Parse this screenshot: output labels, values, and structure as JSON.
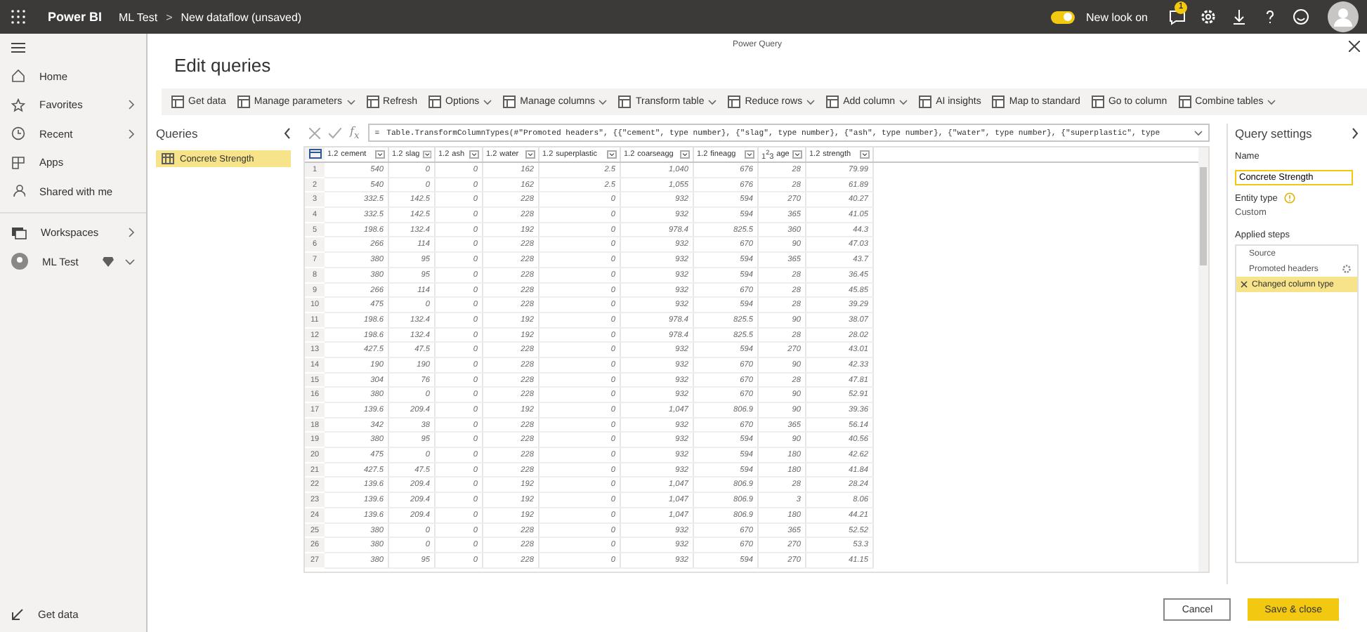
{
  "topbar": {
    "app": "Power BI",
    "breadcrumb": [
      "ML Test",
      "New dataflow (unsaved)"
    ],
    "separator": ">",
    "new_look": {
      "label": "New look on",
      "on": true
    },
    "notifications": "1"
  },
  "nav": {
    "items": [
      {
        "label": "Home",
        "chevron": false
      },
      {
        "label": "Favorites",
        "chevron": true
      },
      {
        "label": "Recent",
        "chevron": true
      },
      {
        "label": "Apps",
        "chevron": false
      },
      {
        "label": "Shared with me",
        "chevron": false
      }
    ],
    "workspaces": [
      {
        "label": "Workspaces",
        "kind": "link"
      },
      {
        "label": "ML Test",
        "kind": "workspace"
      }
    ],
    "footer": "Get data"
  },
  "dialog": {
    "caption": "Power Query",
    "title": "Edit queries",
    "toolbar": [
      {
        "label": "Get data",
        "dropdown": false
      },
      {
        "label": "Manage parameters",
        "dropdown": true
      },
      {
        "label": "Refresh",
        "dropdown": false
      },
      {
        "label": "Options",
        "dropdown": true
      },
      {
        "label": "Manage columns",
        "dropdown": true
      },
      {
        "label": "Transform table",
        "dropdown": true
      },
      {
        "label": "Reduce rows",
        "dropdown": true
      },
      {
        "label": "Add column",
        "dropdown": true
      },
      {
        "label": "AI insights",
        "dropdown": false
      },
      {
        "label": "Map to standard",
        "dropdown": false
      },
      {
        "label": "Go to column",
        "dropdown": false
      },
      {
        "label": "Combine tables",
        "dropdown": true
      }
    ],
    "queries": {
      "title": "Queries",
      "items": [
        {
          "label": "Concrete Strength",
          "selected": true
        }
      ]
    },
    "formula": {
      "fx": "f$_{x}$",
      "prefix": "=",
      "text": "Table.TransformColumnTypes(#\"Promoted headers\", {{\"cement\", type number}, {\"slag\", type number}, {\"ash\", type number}, {\"water\", type number}, {\"superplastic\", type"
    },
    "table": {
      "columns": [
        {
          "type": "1.2",
          "name": "cement"
        },
        {
          "type": "1.2",
          "name": "slag"
        },
        {
          "type": "1.2",
          "name": "ash"
        },
        {
          "type": "1.2",
          "name": "water"
        },
        {
          "type": "1.2",
          "name": "superplastic"
        },
        {
          "type": "1.2",
          "name": "coarseagg"
        },
        {
          "type": "1.2",
          "name": "fineagg"
        },
        {
          "type": "1$^{2}$3",
          "name": "age"
        },
        {
          "type": "1.2",
          "name": "strength"
        }
      ],
      "rows": [
        [
          "1",
          "540",
          "0",
          "0",
          "162",
          "2.5",
          "1,040",
          "676",
          "28",
          "79.99"
        ],
        [
          "2",
          "540",
          "0",
          "0",
          "162",
          "2.5",
          "1,055",
          "676",
          "28",
          "61.89"
        ],
        [
          "3",
          "332.5",
          "142.5",
          "0",
          "228",
          "0",
          "932",
          "594",
          "270",
          "40.27"
        ],
        [
          "4",
          "332.5",
          "142.5",
          "0",
          "228",
          "0",
          "932",
          "594",
          "365",
          "41.05"
        ],
        [
          "5",
          "198.6",
          "132.4",
          "0",
          "192",
          "0",
          "978.4",
          "825.5",
          "360",
          "44.3"
        ],
        [
          "6",
          "266",
          "114",
          "0",
          "228",
          "0",
          "932",
          "670",
          "90",
          "47.03"
        ],
        [
          "7",
          "380",
          "95",
          "0",
          "228",
          "0",
          "932",
          "594",
          "365",
          "43.7"
        ],
        [
          "8",
          "380",
          "95",
          "0",
          "228",
          "0",
          "932",
          "594",
          "28",
          "36.45"
        ],
        [
          "9",
          "266",
          "114",
          "0",
          "228",
          "0",
          "932",
          "670",
          "28",
          "45.85"
        ],
        [
          "10",
          "475",
          "0",
          "0",
          "228",
          "0",
          "932",
          "594",
          "28",
          "39.29"
        ],
        [
          "11",
          "198.6",
          "132.4",
          "0",
          "192",
          "0",
          "978.4",
          "825.5",
          "90",
          "38.07"
        ],
        [
          "12",
          "198.6",
          "132.4",
          "0",
          "192",
          "0",
          "978.4",
          "825.5",
          "28",
          "28.02"
        ],
        [
          "13",
          "427.5",
          "47.5",
          "0",
          "228",
          "0",
          "932",
          "594",
          "270",
          "43.01"
        ],
        [
          "14",
          "190",
          "190",
          "0",
          "228",
          "0",
          "932",
          "670",
          "90",
          "42.33"
        ],
        [
          "15",
          "304",
          "76",
          "0",
          "228",
          "0",
          "932",
          "670",
          "28",
          "47.81"
        ],
        [
          "16",
          "380",
          "0",
          "0",
          "228",
          "0",
          "932",
          "670",
          "90",
          "52.91"
        ],
        [
          "17",
          "139.6",
          "209.4",
          "0",
          "192",
          "0",
          "1,047",
          "806.9",
          "90",
          "39.36"
        ],
        [
          "18",
          "342",
          "38",
          "0",
          "228",
          "0",
          "932",
          "670",
          "365",
          "56.14"
        ],
        [
          "19",
          "380",
          "95",
          "0",
          "228",
          "0",
          "932",
          "594",
          "90",
          "40.56"
        ],
        [
          "20",
          "475",
          "0",
          "0",
          "228",
          "0",
          "932",
          "594",
          "180",
          "42.62"
        ],
        [
          "21",
          "427.5",
          "47.5",
          "0",
          "228",
          "0",
          "932",
          "594",
          "180",
          "41.84"
        ],
        [
          "22",
          "139.6",
          "209.4",
          "0",
          "192",
          "0",
          "1,047",
          "806.9",
          "28",
          "28.24"
        ],
        [
          "23",
          "139.6",
          "209.4",
          "0",
          "192",
          "0",
          "1,047",
          "806.9",
          "3",
          "8.06"
        ],
        [
          "24",
          "139.6",
          "209.4",
          "0",
          "192",
          "0",
          "1,047",
          "806.9",
          "180",
          "44.21"
        ],
        [
          "25",
          "380",
          "0",
          "0",
          "228",
          "0",
          "932",
          "670",
          "365",
          "52.52"
        ],
        [
          "26",
          "380",
          "0",
          "0",
          "228",
          "0",
          "932",
          "670",
          "270",
          "53.3"
        ],
        [
          "27",
          "380",
          "95",
          "0",
          "228",
          "0",
          "932",
          "594",
          "270",
          "41.15"
        ]
      ]
    },
    "settings": {
      "title": "Query settings",
      "name_label": "Name",
      "name_value": "Concrete Strength",
      "entity_label": "Entity type",
      "entity_value": "Custom",
      "steps_label": "Applied steps",
      "steps": [
        {
          "label": "Source",
          "selected": false,
          "gear": false
        },
        {
          "label": "Promoted headers",
          "selected": false,
          "gear": true
        },
        {
          "label": "Changed column type",
          "selected": true,
          "gear": false
        }
      ]
    },
    "buttons": [
      {
        "label": "Cancel",
        "kind": "secondary"
      },
      {
        "label": "Save & close",
        "kind": "primary"
      }
    ]
  }
}
